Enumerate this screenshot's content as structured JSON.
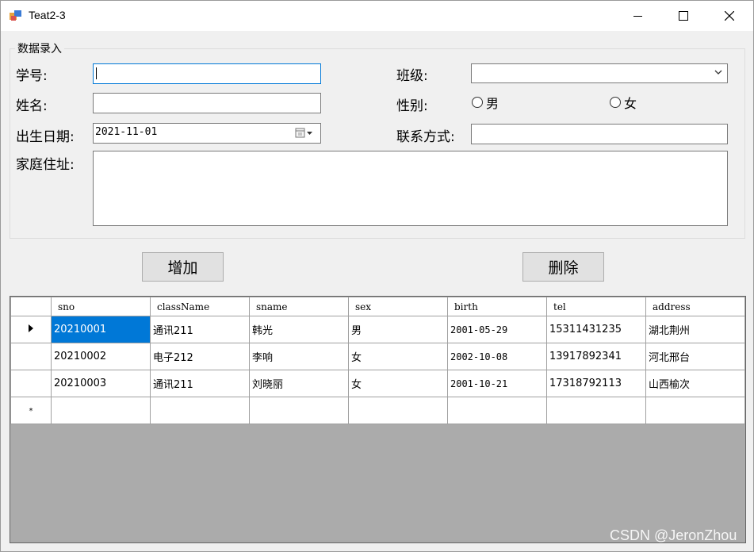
{
  "window": {
    "title": "Teat2-3"
  },
  "group": {
    "title": "数据录入"
  },
  "form": {
    "sno_label": "学号:",
    "name_label": "姓名:",
    "birth_label": "出生日期:",
    "birth_value": "2021-11-01",
    "address_label": "家庭住址:",
    "class_label": "班级:",
    "sex_label": "性别:",
    "sex_options": [
      "男",
      "女"
    ],
    "tel_label": "联系方式:"
  },
  "buttons": {
    "add": "增加",
    "delete": "删除"
  },
  "grid": {
    "columns": [
      "sno",
      "className",
      "sname",
      "sex",
      "birth",
      "tel",
      "address"
    ],
    "rows": [
      [
        "20210001",
        "通讯211",
        "韩光",
        "男",
        "2001-05-29",
        "15311431235",
        "湖北荆州"
      ],
      [
        "20210002",
        "电子212",
        "李响",
        "女",
        "2002-10-08",
        "13917892341",
        "河北邢台"
      ],
      [
        "20210003",
        "通讯211",
        "刘晓丽",
        "女",
        "2001-10-21",
        "17318792113",
        "山西榆次"
      ]
    ],
    "new_row_marker": "*"
  },
  "watermark": "CSDN @JeronZhou",
  "colors": {
    "selection": "#0078d7",
    "grid_background": "#ababab",
    "focus_border": "#0078d7"
  }
}
